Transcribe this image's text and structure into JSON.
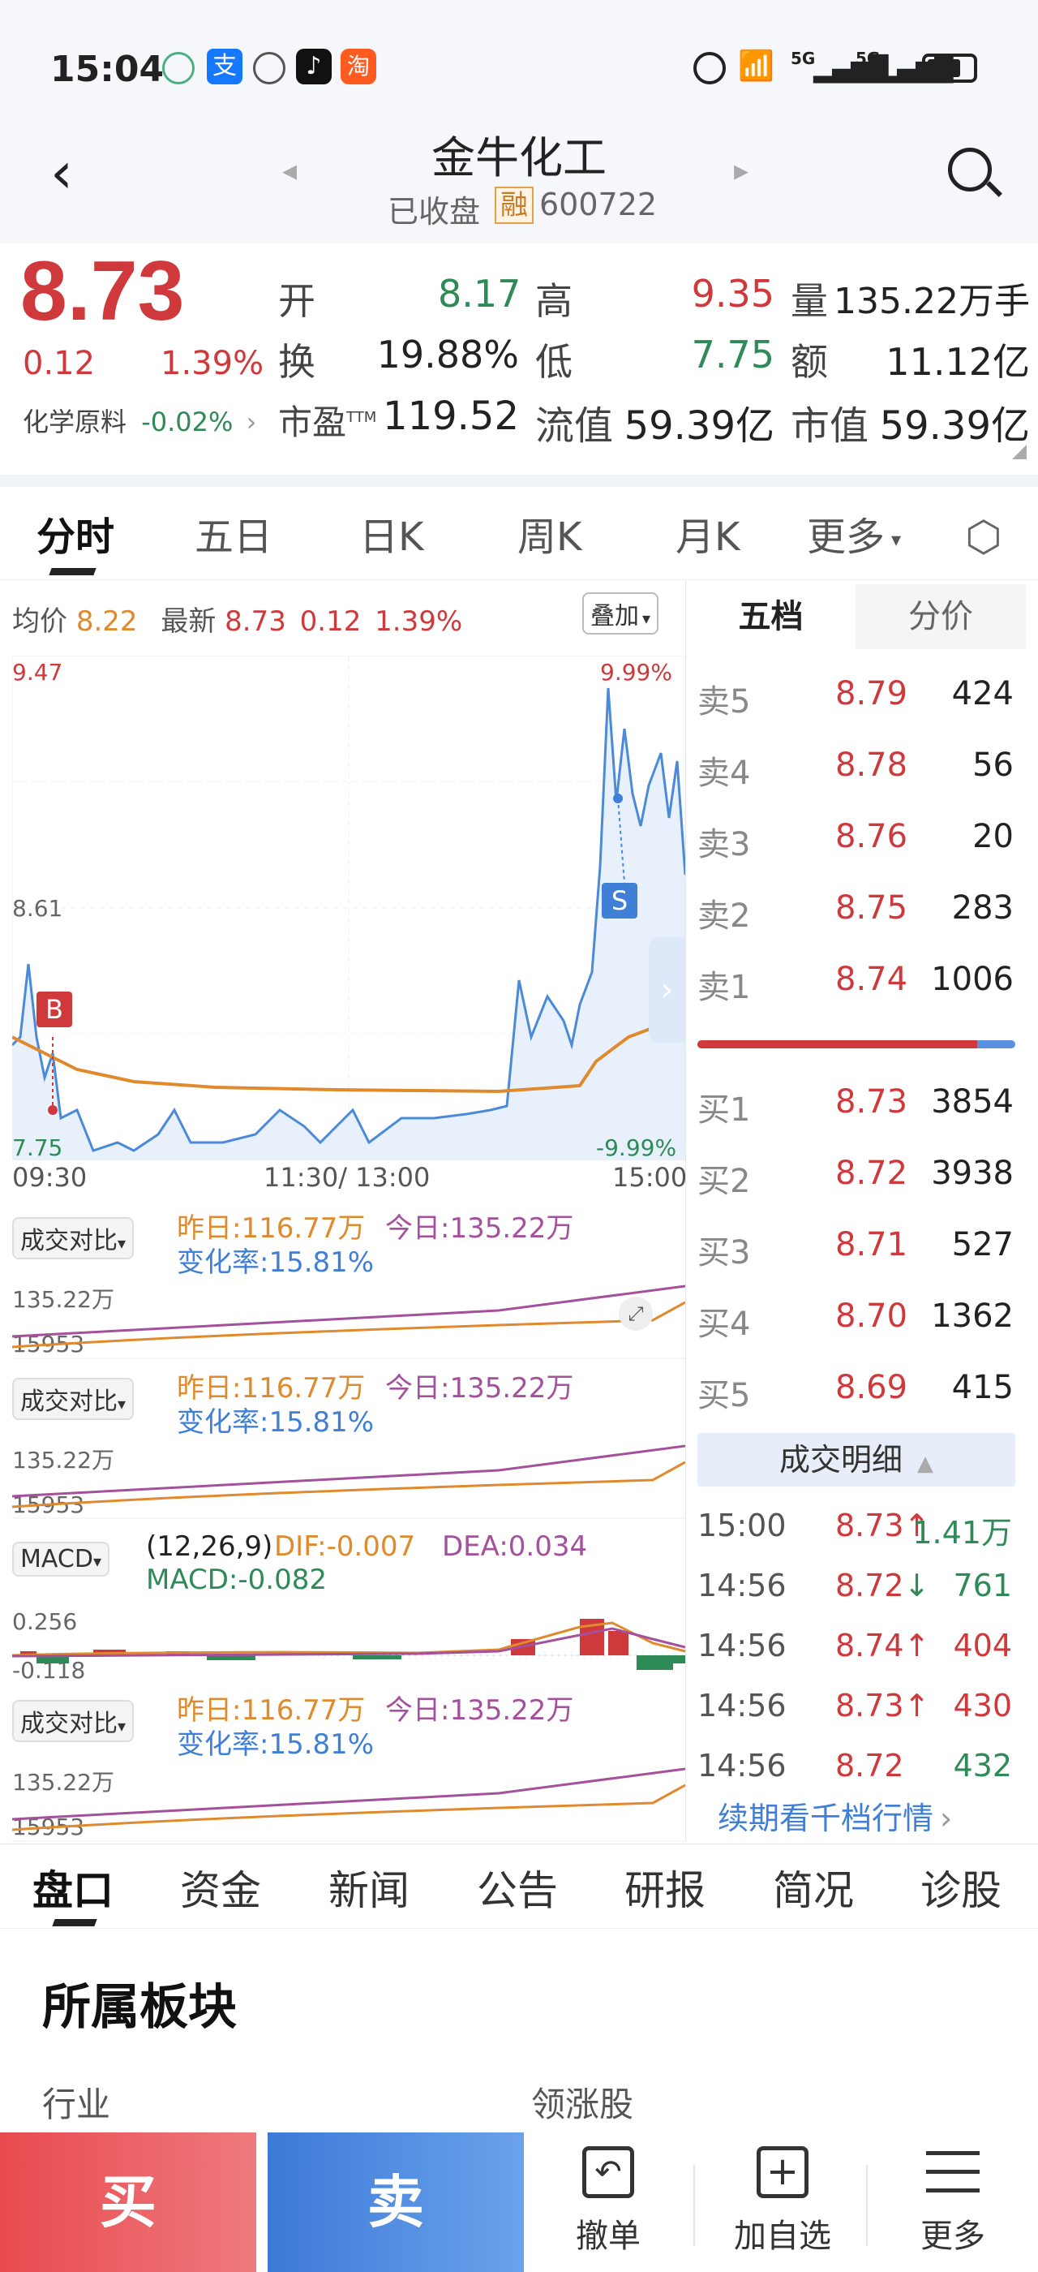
{
  "status_bar": {
    "time": "15:04",
    "signal1": "5G",
    "signal2": "5G"
  },
  "header": {
    "stock_name": "金牛化工",
    "status": "已收盘",
    "margin_badge": "融",
    "code": "600722"
  },
  "quote": {
    "price": "8.73",
    "change": "0.12",
    "change_pct": "1.39%",
    "sector_name": "化学原料",
    "sector_change": "-0.02%",
    "open_label": "开",
    "open": "8.17",
    "high_label": "高",
    "high": "9.35",
    "volume_label": "量",
    "volume": "135.22万手",
    "turnover_label": "换",
    "turnover": "19.88%",
    "low_label": "低",
    "low": "7.75",
    "amount_label": "额",
    "amount": "11.12亿",
    "pe_label": "市盈",
    "pe_sup": "TTM",
    "pe": "119.52",
    "float_cap_label": "流值",
    "float_cap": "59.39亿",
    "mkt_cap_label": "市值",
    "mkt_cap": "59.39亿"
  },
  "chart_tabs": [
    "分时",
    "五日",
    "日K",
    "周K",
    "月K",
    "更多"
  ],
  "info_line": {
    "avg_label": "均价",
    "avg": "8.22",
    "latest_label": "最新",
    "latest": "8.73",
    "chg": "0.12",
    "pct": "1.39%",
    "overlay_button": "叠加"
  },
  "chart_labels": {
    "y_high": "9.47",
    "y_mid": "8.61",
    "y_low": "7.75",
    "pct_high": "9.99%",
    "pct_low": "-9.99%",
    "t_start": "09:30",
    "t_mid": "11:30/ 13:00",
    "t_end": "15:00",
    "buy_marker": "B",
    "sell_marker": "S"
  },
  "volume_panels": [
    {
      "selector": "成交对比",
      "yesterday": "昨日:116.77万",
      "today": "今日:135.22万",
      "change": "变化率:15.81%",
      "y_top": "135.22万",
      "y_bot": "15953"
    },
    {
      "selector": "成交对比",
      "yesterday": "昨日:116.77万",
      "today": "今日:135.22万",
      "change": "变化率:15.81%",
      "y_top": "135.22万",
      "y_bot": "15953"
    },
    {
      "selector": "成交对比",
      "yesterday": "昨日:116.77万",
      "today": "今日:135.22万",
      "change": "变化率:15.81%",
      "y_top": "135.22万",
      "y_bot": "15953"
    }
  ],
  "macd_panel": {
    "selector": "MACD",
    "params": "(12,26,9)",
    "dif": "DIF:-0.007",
    "dea": "DEA:0.034",
    "macd": "MACD:-0.082",
    "y_top": "0.256",
    "y_bot": "-0.118"
  },
  "order_book": {
    "tab_five": "五档",
    "tab_price": "分价",
    "sell": [
      {
        "label": "卖5",
        "price": "8.79",
        "vol": "424"
      },
      {
        "label": "卖4",
        "price": "8.78",
        "vol": "56"
      },
      {
        "label": "卖3",
        "price": "8.76",
        "vol": "20"
      },
      {
        "label": "卖2",
        "price": "8.75",
        "vol": "283"
      },
      {
        "label": "卖1",
        "price": "8.74",
        "vol": "1006"
      }
    ],
    "buy": [
      {
        "label": "买1",
        "price": "8.73",
        "vol": "3854"
      },
      {
        "label": "买2",
        "price": "8.72",
        "vol": "3938"
      },
      {
        "label": "买3",
        "price": "8.71",
        "vol": "527"
      },
      {
        "label": "买4",
        "price": "8.70",
        "vol": "1362"
      },
      {
        "label": "买5",
        "price": "8.69",
        "vol": "415"
      }
    ],
    "buy_ratio": 0.88
  },
  "trades": {
    "header": "成交明细",
    "rows": [
      {
        "time": "15:00",
        "price": "8.73",
        "dir": "↑",
        "vol": "1.41万"
      },
      {
        "time": "14:56",
        "price": "8.72",
        "dir": "↓",
        "vol": "761"
      },
      {
        "time": "14:56",
        "price": "8.74",
        "dir": "↑",
        "vol": "404"
      },
      {
        "time": "14:56",
        "price": "8.73",
        "dir": "↑",
        "vol": "430"
      },
      {
        "time": "14:56",
        "price": "8.72",
        "dir": "",
        "vol": "432"
      }
    ],
    "more_link": "续期看千档行情"
  },
  "bottom_tabs": [
    "盘口",
    "资金",
    "新闻",
    "公告",
    "研报",
    "简况",
    "诊股"
  ],
  "section": {
    "title": "所属板块",
    "col1": "行业",
    "col2": "领涨股"
  },
  "actions": {
    "buy": "买",
    "sell": "卖",
    "cancel": "撤单",
    "add_watch": "加自选",
    "more": "更多"
  },
  "colors": {
    "up": "#d0393b",
    "down": "#2e8b57",
    "price_line": "#4a8ad8",
    "avg_line": "#e08a2d",
    "buy_btn": "#e9555a",
    "sell_btn": "#3f7fd6"
  }
}
